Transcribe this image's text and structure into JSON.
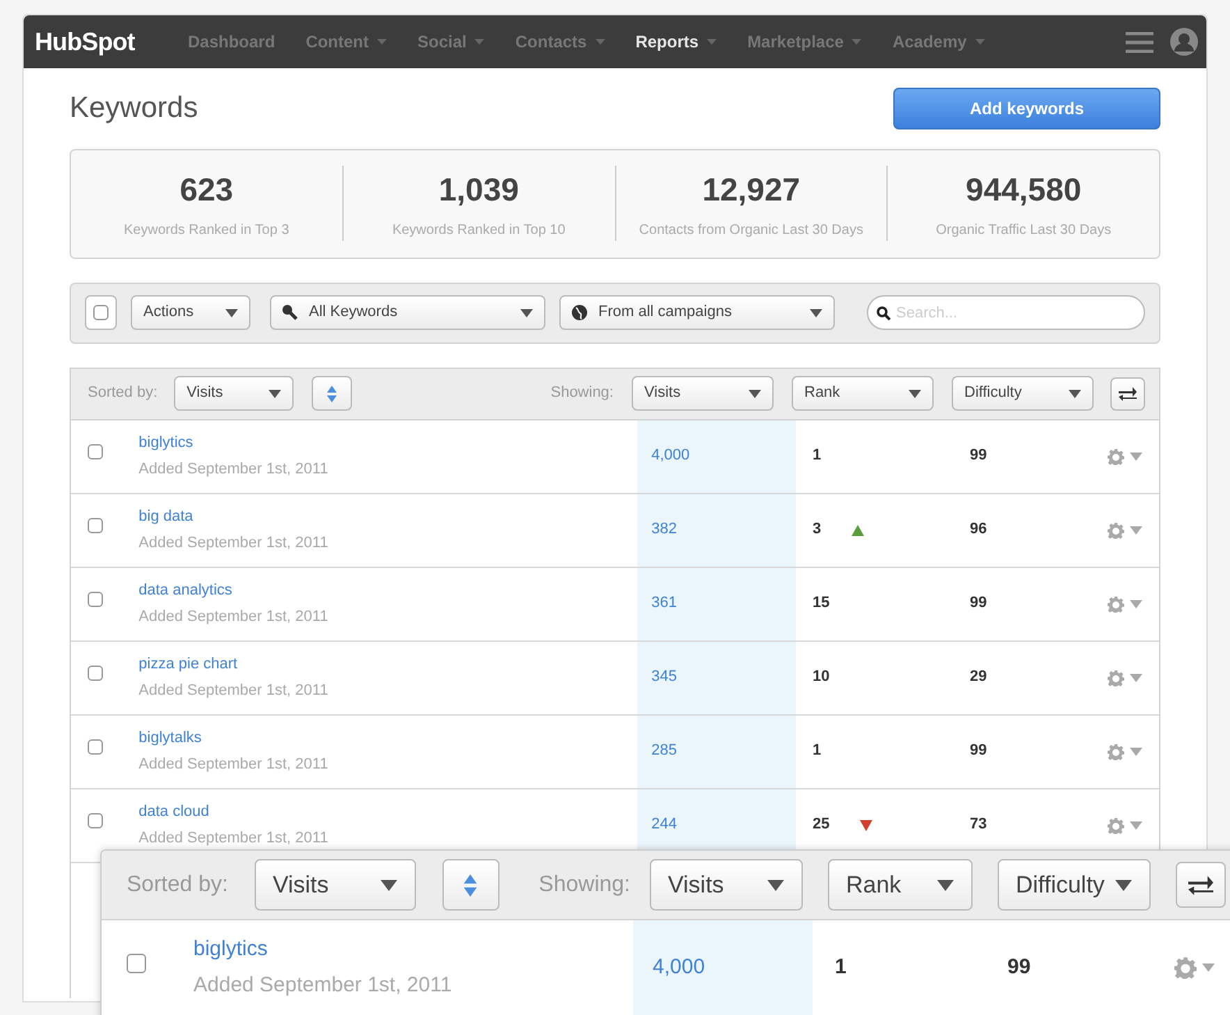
{
  "nav": {
    "logo": "HubSpot",
    "items": [
      {
        "label": "Dashboard",
        "selected": false,
        "menu": false
      },
      {
        "label": "Content",
        "selected": false,
        "menu": true
      },
      {
        "label": "Social",
        "selected": false,
        "menu": true
      },
      {
        "label": "Contacts",
        "selected": false,
        "menu": true
      },
      {
        "label": "Reports",
        "selected": true,
        "menu": true
      },
      {
        "label": "Marketplace",
        "selected": false,
        "menu": true
      },
      {
        "label": "Academy",
        "selected": false,
        "menu": true
      }
    ]
  },
  "title": "Keywords",
  "add_button": "Add keywords",
  "stats": [
    {
      "value": "623",
      "label": "Keywords Ranked in Top 3"
    },
    {
      "value": "1,039",
      "label": "Keywords Ranked in Top 10"
    },
    {
      "value": "12,927",
      "label": "Contacts from Organic Last 30 Days"
    },
    {
      "value": "944,580",
      "label": "Organic Traffic Last 30 Days"
    }
  ],
  "toolbar": {
    "select_all": {
      "checked": false
    },
    "actions": "Actions",
    "filter": "All Keywords",
    "campaigns": "From all campaigns",
    "search": {
      "placeholder": "Search..."
    }
  },
  "table": {
    "sorted_label": "Sorted by:",
    "sort_value": "Visits",
    "showing_label": "Showing:",
    "columns": [
      "Visits",
      "Rank",
      "Difficulty"
    ],
    "rows": [
      {
        "keyword": "biglytics",
        "added": "Added September 1st, 2011",
        "visits": "4,000",
        "rank": "1",
        "rank_up": false,
        "rank_down": false,
        "difficulty": "99",
        "checked": false
      },
      {
        "keyword": "big data",
        "added": "Added September 1st, 2011",
        "visits": "382",
        "rank": "3",
        "rank_up": true,
        "rank_down": false,
        "difficulty": "96",
        "checked": false
      },
      {
        "keyword": "data analytics",
        "added": "Added September 1st, 2011",
        "visits": "361",
        "rank": "15",
        "rank_up": false,
        "rank_down": false,
        "difficulty": "99",
        "checked": false
      },
      {
        "keyword": "pizza pie chart",
        "added": "Added September 1st, 2011",
        "visits": "345",
        "rank": "10",
        "rank_up": false,
        "rank_down": false,
        "difficulty": "29",
        "checked": false
      },
      {
        "keyword": "biglytalks",
        "added": "Added September 1st, 2011",
        "visits": "285",
        "rank": "1",
        "rank_up": false,
        "rank_down": false,
        "difficulty": "99",
        "checked": false
      },
      {
        "keyword": "data cloud",
        "added": "Added September 1st, 2011",
        "visits": "244",
        "rank": "25",
        "rank_up": false,
        "rank_down": true,
        "difficulty": "73",
        "checked": false
      }
    ]
  },
  "callout": {
    "sorted_label": "Sorted by:",
    "sort_value": "Visits",
    "showing_label": "Showing:",
    "columns": [
      "Visits",
      "Rank",
      "Difficulty"
    ],
    "row": {
      "keyword": "biglytics",
      "added": "Added September 1st, 2011",
      "visits": "4,000",
      "rank": "1",
      "difficulty": "99",
      "checked": false
    }
  }
}
